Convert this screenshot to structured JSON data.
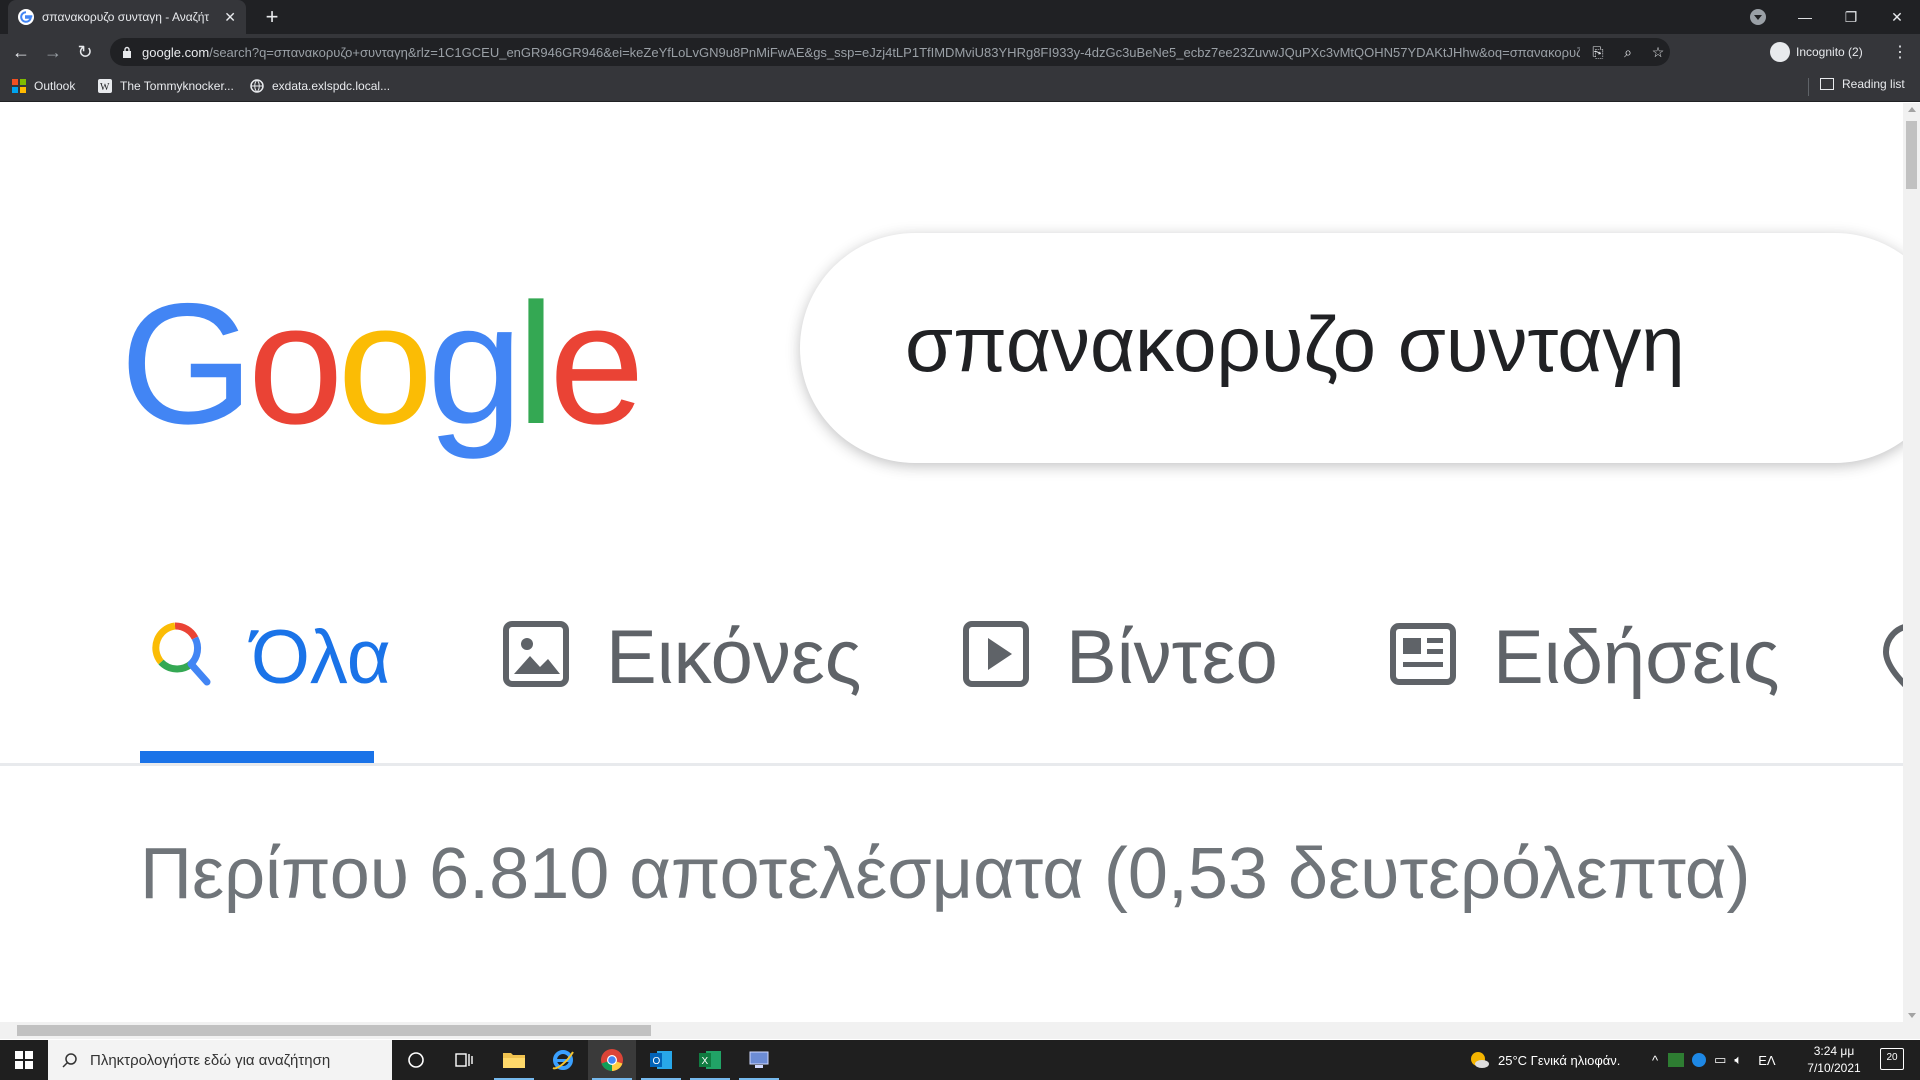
{
  "browser": {
    "tab_title": "σπανακορυζο συνταγη - Αναζήτ",
    "address_host": "google.com",
    "address_path": "/search?q=σπανακορυζο+συνταγη&rlz=1C1GCEU_enGR946GR946&ei=keZeYfLoLvGN9u8PnMiFwAE&gs_ssp=eJzj4tLP1TfIMDMviU83YHRg8FI933y-4dzGc3uBeNe5_ecbz7ee23ZuvwJQuPXc3vMtQOHN57YDAKtJHhw&oq=σπανακορυζ...",
    "incognito_label": "Incognito (2)",
    "bookmarks": [
      "Outlook",
      "The Tommyknocker...",
      "exdata.exlspdc.local..."
    ],
    "reading_list": "Reading list"
  },
  "page": {
    "logo_letters": [
      "G",
      "o",
      "o",
      "g",
      "l",
      "e"
    ],
    "query": "σπανακορυζο συνταγη",
    "tabs": [
      {
        "label": "Όλα",
        "icon": "search-multicolor-icon",
        "active": true
      },
      {
        "label": "Εικόνες",
        "icon": "image-icon",
        "active": false
      },
      {
        "label": "Βίντεο",
        "icon": "video-play-icon",
        "active": false
      },
      {
        "label": "Ειδήσεις",
        "icon": "news-icon",
        "active": false
      }
    ],
    "results_count": "Περίπου 6.810 αποτελέσματα (0,53 δευτερόλεπτα)"
  },
  "taskbar": {
    "search_placeholder": "Πληκτρολογήστε εδώ για αναζήτηση",
    "weather": "25°C  Γενικά ηλιοφάν.",
    "language": "ΕΛ",
    "time": "3:24 μμ",
    "date": "7/10/2021",
    "notifications": "20"
  },
  "colors": {
    "google_blue": "#4285f4",
    "google_red": "#ea4335",
    "google_yellow": "#fbbc05",
    "google_green": "#34a853",
    "accent": "#1a73e8"
  }
}
